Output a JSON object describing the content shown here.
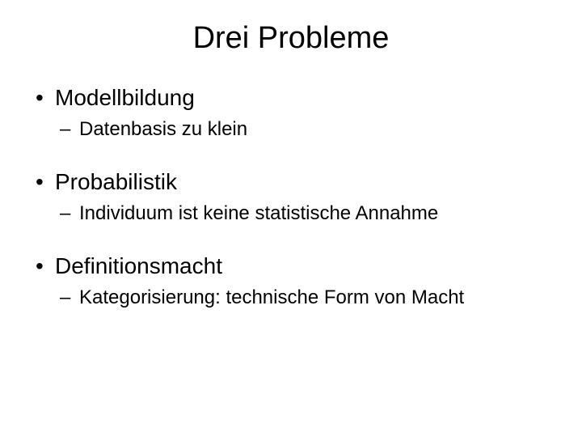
{
  "title": "Drei Probleme",
  "items": [
    {
      "label": "Modellbildung",
      "sub": "Datenbasis zu klein"
    },
    {
      "label": "Probabilistik",
      "sub": "Individuum ist keine statistische Annahme"
    },
    {
      "label": "Definitionsmacht",
      "sub": "Kategorisierung: technische Form von Macht"
    }
  ]
}
